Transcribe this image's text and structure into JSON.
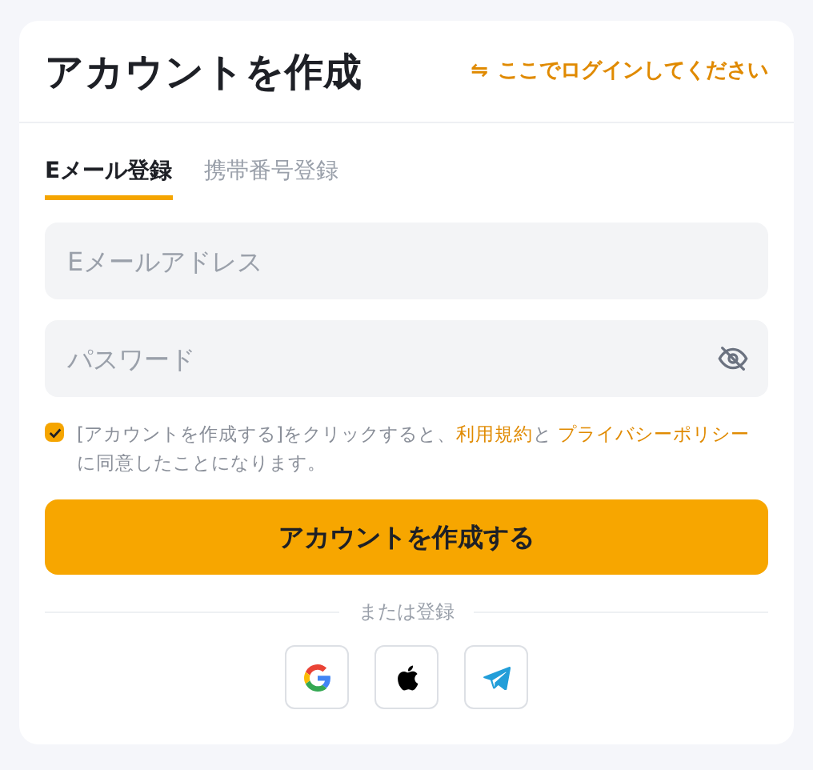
{
  "title": "アカウントを作成",
  "login_link": {
    "icon": "⇋",
    "label": "ここでログインしてください"
  },
  "tabs": [
    {
      "label": "Eメール登録",
      "selected": true
    },
    {
      "label": "携帯番号登録",
      "selected": false
    }
  ],
  "email_field": {
    "placeholder": "Eメールアドレス"
  },
  "password_field": {
    "placeholder": "パスワード"
  },
  "consent": {
    "checked": true,
    "before": "[アカウントを作成する]をクリックすると、",
    "terms_link": "利用規約",
    "between": "と ",
    "privacy_link": "プライバシーポリシー",
    "after": "に同意したことになります。"
  },
  "submit_button": "アカウントを作成する",
  "divider_label": "または登録",
  "social_buttons": [
    {
      "kind": "google"
    },
    {
      "kind": "apple"
    },
    {
      "kind": "telegram"
    }
  ]
}
